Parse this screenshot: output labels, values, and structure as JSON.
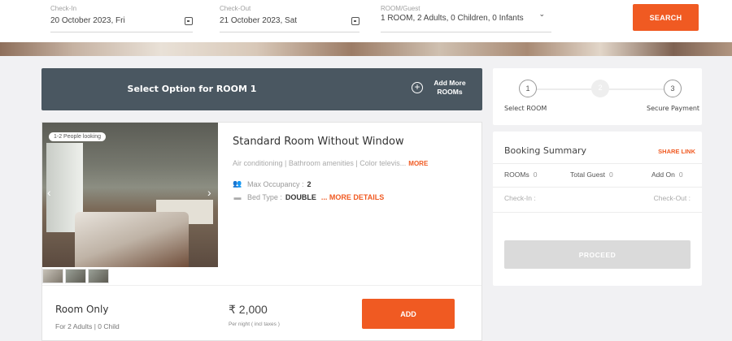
{
  "search": {
    "checkin_label": "Check-In",
    "checkin_value": "20 October 2023, Fri",
    "checkout_label": "Check-Out",
    "checkout_value": "21 October 2023, Sat",
    "guest_label": "ROOM/Guest",
    "guest_value": "1 ROOM, 2 Adults, 0 Children, 0 Infants",
    "button": "SEARCH"
  },
  "option_bar": {
    "title": "Select Option for ROOM 1",
    "add_more": "Add More ROOMs"
  },
  "room": {
    "people_badge": "1-2 People looking",
    "name": "Standard Room Without Window",
    "amenities": "Air conditioning | Bathroom amenities | Color televis...",
    "amenities_more": "MORE",
    "occupancy_label": "Max Occupancy :",
    "occupancy_value": "2",
    "bed_label": "Bed Type :",
    "bed_value": "DOUBLE",
    "more_details": "... MORE DETAILS",
    "arrow_left": "‹",
    "arrow_right": "›"
  },
  "plan": {
    "name": "Room Only",
    "sub": "For 2 Adults | 0 Child",
    "price": "₹ 2,000",
    "price_note": "Per night ( incl taxes )",
    "button": "ADD"
  },
  "steps": [
    {
      "num": "1",
      "label": "Select ROOM"
    },
    {
      "num": "2",
      "label": ""
    },
    {
      "num": "3",
      "label": "Secure Payment"
    }
  ],
  "summary": {
    "title": "Booking Summary",
    "share": "SHARE LINK",
    "rooms_label": "ROOMs",
    "rooms_value": "0",
    "guest_label": "Total Guest",
    "guest_value": "0",
    "addon_label": "Add On",
    "addon_value": "0",
    "checkin": "Check-In :",
    "checkout": "Check-Out :",
    "proceed": "PROCEED"
  },
  "colors": {
    "accent": "#f05a22",
    "option_bar": "#4a5761",
    "disabled": "#dadada"
  }
}
